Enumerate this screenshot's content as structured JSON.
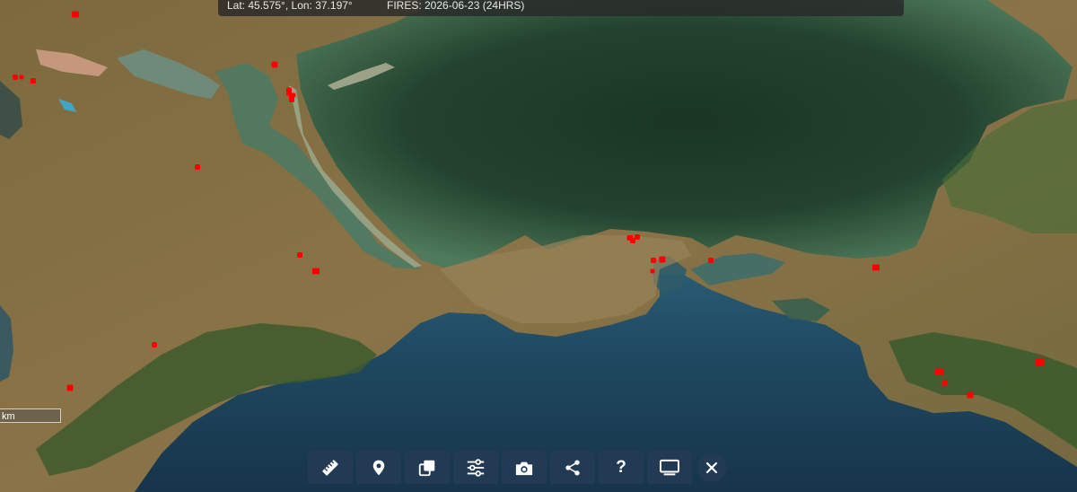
{
  "status": {
    "coords": "Lat: 45.575°, Lon: 37.197°",
    "fires": "FIRES: 2026-06-23 (24HRS)"
  },
  "scale": {
    "unit": "km"
  },
  "colors": {
    "sea_azov": "#1f3b2a",
    "black_sea": "#1c3f56",
    "land": "#8a7446",
    "forest": "#3b5a2d",
    "fire": "#ff0000",
    "toolbar_bg": "#233a55"
  },
  "toolbar": [
    {
      "name": "measure",
      "icon": "ruler-icon"
    },
    {
      "name": "marker",
      "icon": "map-pin-icon"
    },
    {
      "name": "layers",
      "icon": "layers-icon"
    },
    {
      "name": "filters",
      "icon": "sliders-icon"
    },
    {
      "name": "snapshot",
      "icon": "camera-icon"
    },
    {
      "name": "share",
      "icon": "share-icon"
    },
    {
      "name": "help",
      "icon": "help-icon"
    },
    {
      "name": "present",
      "icon": "monitor-icon"
    },
    {
      "name": "close",
      "icon": "close-icon"
    }
  ],
  "fire_count": 27
}
